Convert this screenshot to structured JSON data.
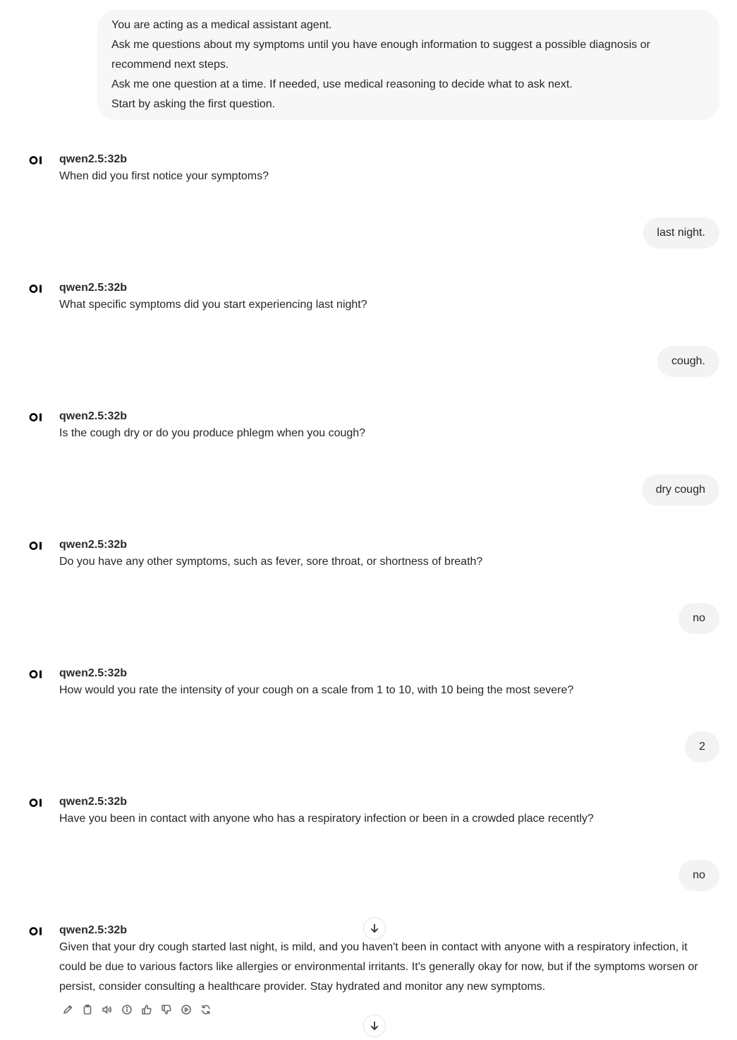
{
  "system_message": {
    "lines": [
      "You are acting as a medical assistant agent.",
      "Ask me questions about my symptoms until you have enough information to suggest a possible diagnosis or recommend next steps.",
      "Ask me one question at a time. If needed, use medical reasoning to decide what to ask next.",
      "Start by asking the first question."
    ]
  },
  "model_name": "qwen2.5:32b",
  "avatar_icon": "open-webui-logo-icon",
  "turns": [
    {
      "assistant": "When did you first notice your symptoms?",
      "user": "last night."
    },
    {
      "assistant": "What specific symptoms did you start experiencing last night?",
      "user": "cough."
    },
    {
      "assistant": "Is the cough dry or do you produce phlegm when you cough?",
      "user": "dry cough"
    },
    {
      "assistant": "Do you have any other symptoms, such as fever, sore throat, or shortness of breath?",
      "user": "no"
    },
    {
      "assistant": "How would you rate the intensity of your cough on a scale from 1 to 10, with 10 being the most severe?",
      "user": "2"
    },
    {
      "assistant": "Have you been in contact with anyone who has a respiratory infection or been in a crowded place recently?",
      "user": "no"
    }
  ],
  "final_response": {
    "lines": [
      "Given that your dry cough started last night, is mild, and you haven't been in contact with anyone with a respiratory infection, it",
      "could be due to various factors like allergies or environmental irritants. It's generally okay for now, but if the symptoms worsen or",
      "persist, consider consulting a healthcare provider. Stay hydrated and monitor any new symptoms."
    ]
  },
  "action_icons": [
    "edit-icon",
    "copy-icon",
    "read-aloud-icon",
    "info-icon",
    "thumbs-up-icon",
    "thumbs-down-icon",
    "continue-response-icon",
    "regenerate-icon"
  ],
  "scroll_icons": [
    "arrow-down-icon",
    "arrow-down-icon"
  ]
}
